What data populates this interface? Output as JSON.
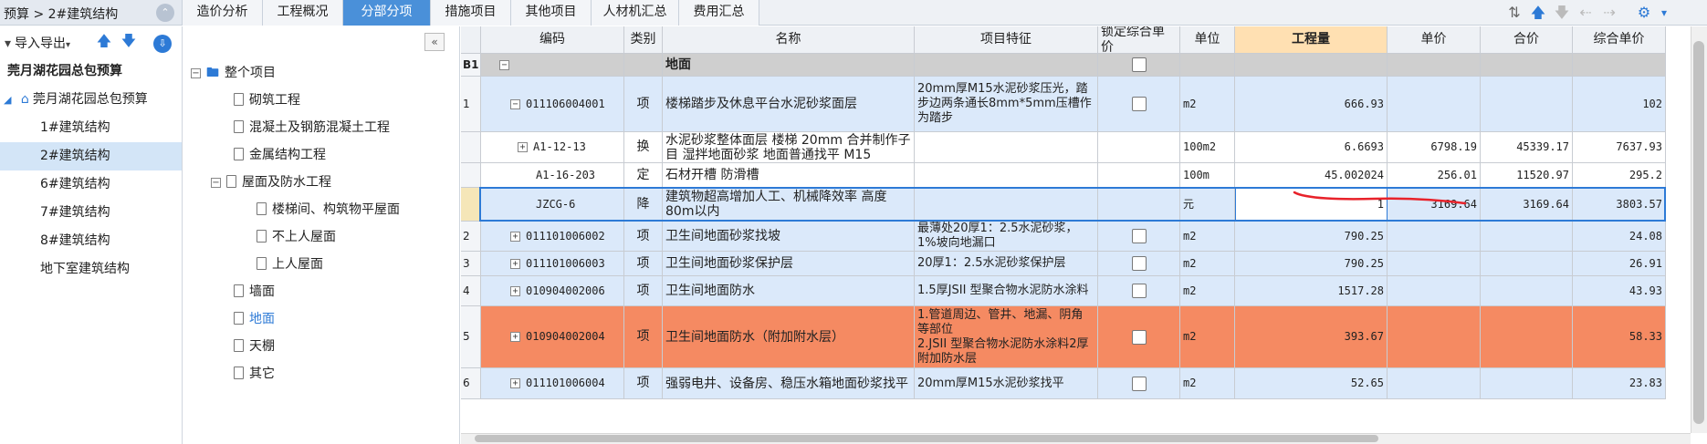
{
  "breadcrumb": "预算 > 2#建筑结构",
  "tabs": [
    {
      "label": "造价分析"
    },
    {
      "label": "工程概况"
    },
    {
      "label": "分部分项"
    },
    {
      "label": "措施项目"
    },
    {
      "label": "其他项目"
    },
    {
      "label": "人材机汇总"
    },
    {
      "label": "费用汇总"
    }
  ],
  "active_tab": "分部分项",
  "toolbar": {
    "import_export": "导入导出"
  },
  "project_tree": {
    "items": [
      "莞月湖花园总包预算",
      "莞月湖花园总包预算",
      "1#建筑结构",
      "2#建筑结构",
      "6#建筑结构",
      "7#建筑结构",
      "8#建筑结构",
      "地下室建筑结构"
    ]
  },
  "section_tree": {
    "items": [
      "整个项目",
      "砌筑工程",
      "混凝土及钢筋混凝土工程",
      "金属结构工程",
      "屋面及防水工程",
      "楼梯间、构筑物平屋面",
      "不上人屋面",
      "上人屋面",
      "墙面",
      "地面",
      "天棚",
      "其它"
    ]
  },
  "grid": {
    "headers": [
      "编码",
      "类别",
      "名称",
      "项目特征",
      "锁定综合单价",
      "单位",
      "工程量",
      "单价",
      "合价",
      "综合单价"
    ],
    "rows": [
      {
        "idx": "B1",
        "code": "",
        "cat": "",
        "name": "地面",
        "feature": "",
        "unit": "",
        "qty": "",
        "price": "",
        "total": "",
        "comp": ""
      },
      {
        "idx": "1",
        "code": "011106004001",
        "cat": "项",
        "name": "楼梯踏步及休息平台水泥砂浆面层",
        "feature": "20mm厚M15水泥砂浆压光，踏步边两条通长8mm*5mm压槽作为踏步",
        "unit": "m2",
        "qty": "666.93",
        "price": "",
        "total": "",
        "comp": "102"
      },
      {
        "idx": "",
        "code": "A1-12-13",
        "cat": "换",
        "name": "水泥砂浆整体面层 楼梯 20mm 合并制作子目 湿拌地面砂浆 地面普通找平 M15",
        "feature": "",
        "unit": "100m2",
        "qty": "6.6693",
        "price": "6798.19",
        "total": "45339.17",
        "comp": "7637.93"
      },
      {
        "idx": "",
        "code": "A1-16-203",
        "cat": "定",
        "name": "石材开槽 防滑槽",
        "feature": "",
        "unit": "100m",
        "qty": "45.002024",
        "price": "256.01",
        "total": "11520.97",
        "comp": "295.2"
      },
      {
        "idx": "",
        "code": "JZCG-6",
        "cat": "降",
        "name": "建筑物超高增加人工、机械降效率 高度80m以内",
        "feature": "",
        "unit": "元",
        "qty": "1",
        "price": "3169.64",
        "total": "3169.64",
        "comp": "3803.57"
      },
      {
        "idx": "2",
        "code": "011101006002",
        "cat": "项",
        "name": "卫生间地面砂浆找坡",
        "feature": "最薄处20厚1：2.5水泥砂浆，1%坡向地漏口",
        "unit": "m2",
        "qty": "790.25",
        "price": "",
        "total": "",
        "comp": "24.08"
      },
      {
        "idx": "3",
        "code": "011101006003",
        "cat": "项",
        "name": "卫生间地面砂浆保护层",
        "feature": "20厚1：2.5水泥砂浆保护层",
        "unit": "m2",
        "qty": "790.25",
        "price": "",
        "total": "",
        "comp": "26.91"
      },
      {
        "idx": "4",
        "code": "010904002006",
        "cat": "项",
        "name": "卫生间地面防水",
        "feature": "1.5厚JSII 型聚合物水泥防水涂料",
        "unit": "m2",
        "qty": "1517.28",
        "price": "",
        "total": "",
        "comp": "43.93"
      },
      {
        "idx": "5",
        "code": "010904002004",
        "cat": "项",
        "name": "卫生间地面防水（附加附水层）",
        "feature": "1.管道周边、管井、地漏、阴角等部位\n2.JSII 型聚合物水泥防水涂料2厚附加防水层",
        "unit": "m2",
        "qty": "393.67",
        "price": "",
        "total": "",
        "comp": "58.33"
      },
      {
        "idx": "6",
        "code": "011101006004",
        "cat": "项",
        "name": "强弱电井、设备房、稳压水箱地面砂浆找平",
        "feature": "20mm厚M15水泥砂浆找平",
        "unit": "m2",
        "qty": "52.65",
        "price": "",
        "total": "",
        "comp": "23.83"
      }
    ]
  },
  "colors": {
    "accent": "#4a90d9",
    "row_blue": "#dbe9fa",
    "row_orange": "#f58a62",
    "header_highlight": "#ffe0b2",
    "annotation_red": "#e8222a"
  }
}
